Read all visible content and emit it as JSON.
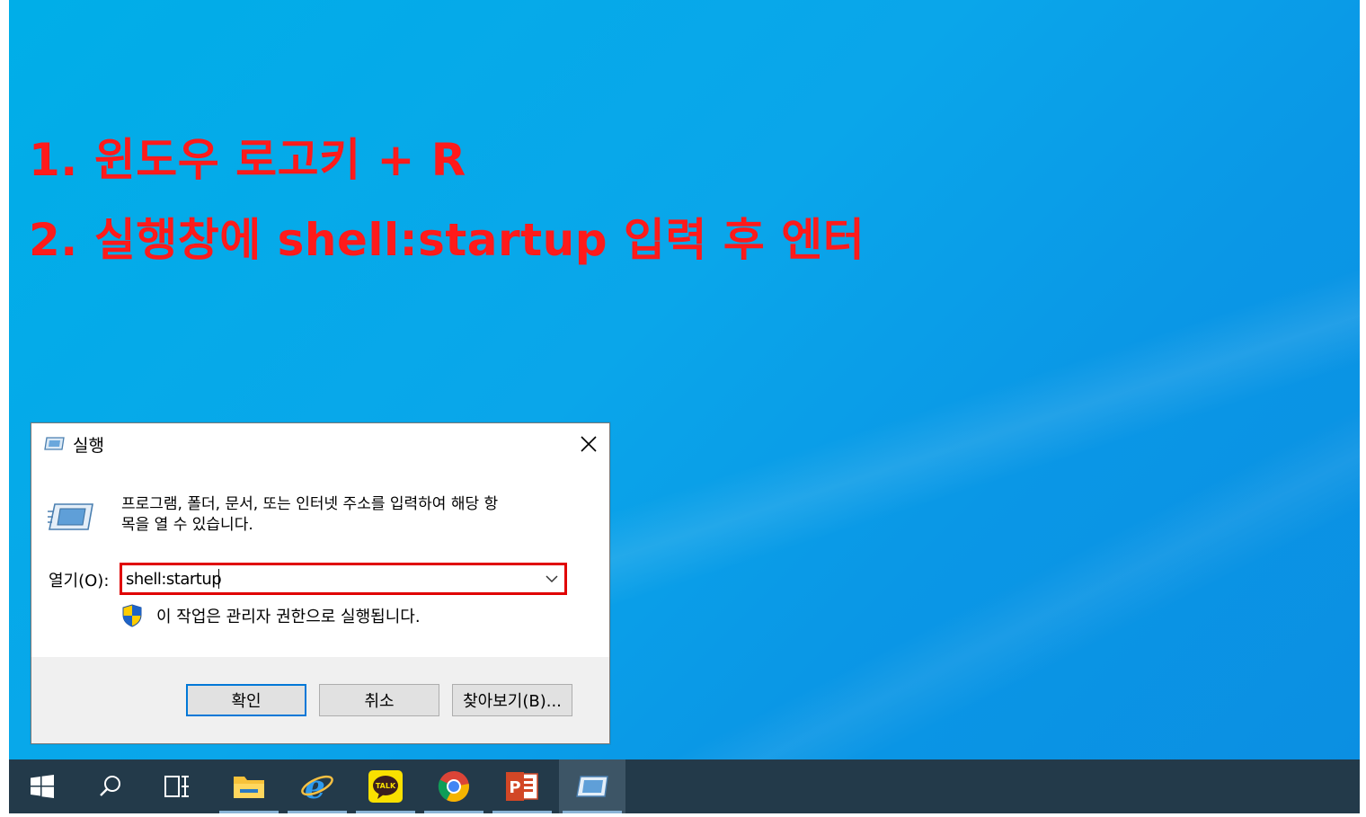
{
  "instructions": {
    "step1": "1. 윈도우 로고키 + R",
    "step2": "2. 실행창에 shell:startup 입력 후 엔터"
  },
  "dialog": {
    "title": "실행",
    "description_line1": "프로그램, 폴더, 문서, 또는 인터넷 주소를 입력하여 해당 항",
    "description_line2": "목을 열 수 있습니다.",
    "open_label": "열기(O):",
    "open_value": "shell:startup",
    "admin_note": "이 작업은 관리자 권한으로 실행됩니다.",
    "ok_label": "확인",
    "cancel_label": "취소",
    "browse_label": "찾아보기(B)...",
    "highlight_color": "#e00000"
  },
  "taskbar": {
    "items": [
      {
        "name": "start",
        "icon": "windows-logo-icon"
      },
      {
        "name": "search",
        "icon": "search-icon"
      },
      {
        "name": "task-view",
        "icon": "task-view-icon"
      },
      {
        "name": "file-explorer",
        "icon": "folder-icon"
      },
      {
        "name": "internet-explorer",
        "icon": "ie-icon"
      },
      {
        "name": "kakaotalk",
        "icon": "kakaotalk-icon",
        "badge": "TALK"
      },
      {
        "name": "chrome",
        "icon": "chrome-icon"
      },
      {
        "name": "powerpoint",
        "icon": "powerpoint-icon",
        "badge": "P"
      },
      {
        "name": "run",
        "icon": "run-icon",
        "active": true
      }
    ]
  }
}
